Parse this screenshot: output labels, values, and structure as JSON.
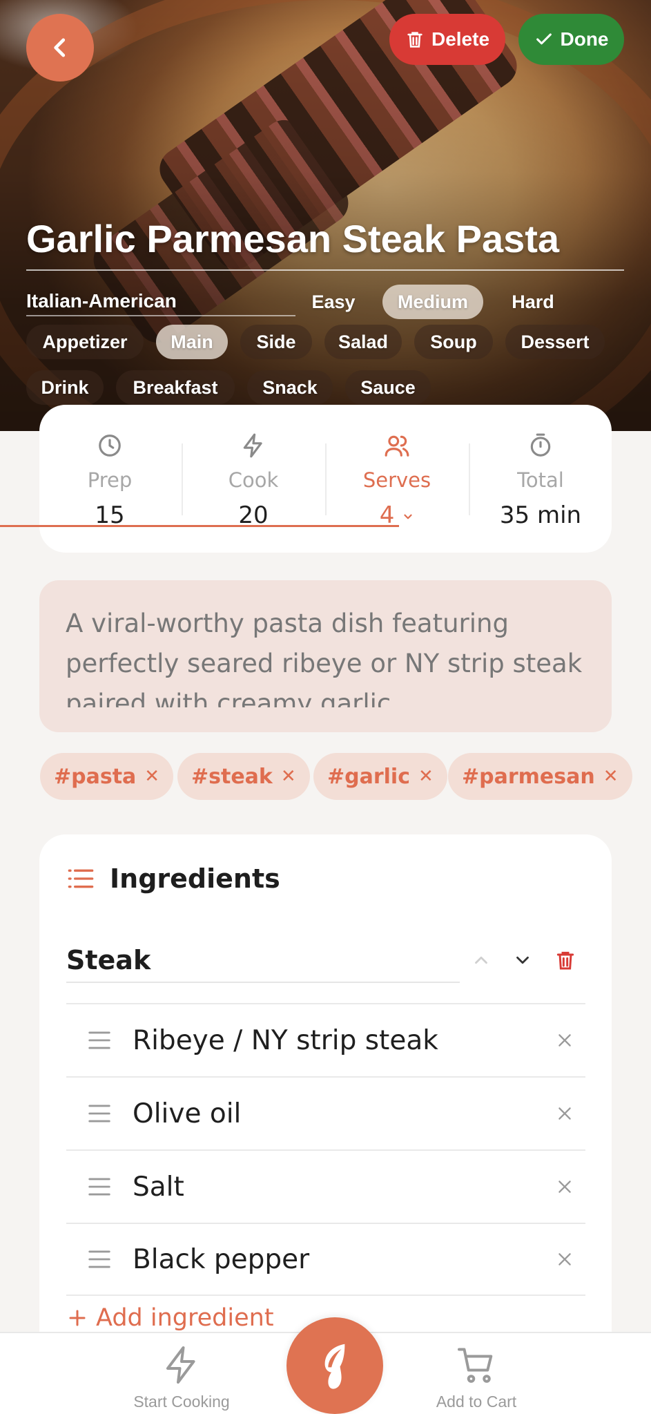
{
  "header": {
    "title": "Garlic Parmesan Steak Pasta",
    "cuisine": "Italian-American",
    "delete_label": "Delete",
    "done_label": "Done"
  },
  "difficulty": {
    "options": [
      "Easy",
      "Medium",
      "Hard"
    ],
    "selected": "Medium"
  },
  "categories": {
    "options": [
      "Appetizer",
      "Main",
      "Side",
      "Salad",
      "Soup",
      "Dessert",
      "Drink",
      "Breakfast",
      "Snack",
      "Sauce"
    ],
    "selected": "Main"
  },
  "stats": {
    "prep": {
      "label": "Prep",
      "value": "15"
    },
    "cook": {
      "label": "Cook",
      "value": "20"
    },
    "serves": {
      "label": "Serves",
      "value": "4"
    },
    "total": {
      "label": "Total",
      "value": "35 min"
    }
  },
  "description": "A viral-worthy pasta dish featuring perfectly seared ribeye or NY strip steak paired with creamy garlic",
  "tags": [
    "#pasta",
    "#steak",
    "#garlic",
    "#parmesan"
  ],
  "ingredients": {
    "heading": "Ingredients",
    "group_name": "Steak",
    "items": [
      "Ribeye / NY strip steak",
      "Olive oil",
      "Salt",
      "Black pepper"
    ],
    "add_label": "Add ingredient"
  },
  "bottom_nav": {
    "start_cooking": "Start Cooking",
    "add_to_cart": "Add to Cart"
  },
  "colors": {
    "accent": "#df7352",
    "delete": "#d83a35",
    "done": "#2f8a37",
    "description_bg": "#f2e2dd",
    "tag_bg": "#f3ded6"
  }
}
